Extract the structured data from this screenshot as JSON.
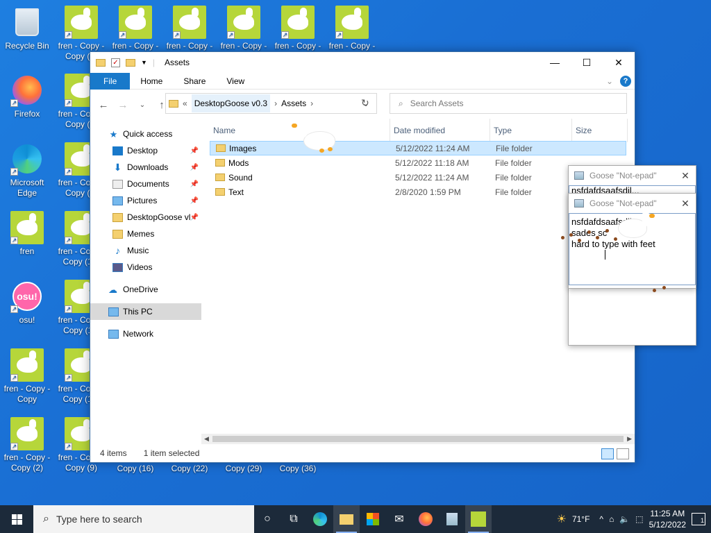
{
  "desktop": {
    "icons": [
      {
        "label": "Recycle Bin"
      },
      {
        "label": "fren - Copy - Copy (5)"
      },
      {
        "label": "fren - Copy - Copy (8)"
      },
      {
        "label": "fren - Copy - Copy (13)"
      },
      {
        "label": "fren - Copy - Copy (21)"
      },
      {
        "label": "fren - Copy - Copy (28)"
      },
      {
        "label": "fren - Copy - Copy (35)"
      },
      {
        "label": "Firefox"
      },
      {
        "label": "fren - Copy - Copy (4)"
      },
      {
        "label": "Microsoft Edge"
      },
      {
        "label": "fren - Copy - Copy (3)"
      },
      {
        "label": "fren"
      },
      {
        "label": "fren - Copy - Copy (12)"
      },
      {
        "label": "osu!"
      },
      {
        "label": "fren - Copy - Copy (11)"
      },
      {
        "label": "fren - Copy - Copy"
      },
      {
        "label": "fren - Copy - Copy (10)"
      },
      {
        "label": "fren - Copy - Copy (2)"
      },
      {
        "label": "fren - Copy - Copy (9)"
      }
    ],
    "bottom_labels": [
      "Copy (16)",
      "Copy (22)",
      "Copy (29)",
      "Copy (36)"
    ],
    "osu_glyph": "osu!"
  },
  "explorer": {
    "title": "Assets",
    "ribbon_tabs": {
      "file": "File",
      "home": "Home",
      "share": "Share",
      "view": "View"
    },
    "address": {
      "crumb_prefix": "«",
      "crumb1": "DesktopGoose v0.3",
      "crumb2": "Assets"
    },
    "search_placeholder": "Search Assets",
    "nav": {
      "quick_access": "Quick access",
      "desktop": "Desktop",
      "downloads": "Downloads",
      "documents": "Documents",
      "pictures": "Pictures",
      "desktopgoose": "DesktopGoose vl",
      "memes": "Memes",
      "music": "Music",
      "videos": "Videos",
      "onedrive": "OneDrive",
      "thispc": "This PC",
      "network": "Network"
    },
    "columns": {
      "name": "Name",
      "date": "Date modified",
      "type": "Type",
      "size": "Size"
    },
    "files": [
      {
        "name": "Images",
        "date": "5/12/2022 11:24 AM",
        "type": "File folder"
      },
      {
        "name": "Mods",
        "date": "5/12/2022 11:18 AM",
        "type": "File folder"
      },
      {
        "name": "Sound",
        "date": "5/12/2022 11:24 AM",
        "type": "File folder"
      },
      {
        "name": "Text",
        "date": "2/8/2020 1:59 PM",
        "type": "File folder"
      }
    ],
    "status": {
      "count": "4 items",
      "selected": "1 item selected"
    }
  },
  "notepads": [
    {
      "title": "Goose \"Not-epad\"",
      "text": "nsfdafdsaafsdil..."
    },
    {
      "title": "Goose \"Not-epad\"",
      "line1": "nsfdafdsaafsdil",
      "line2": "sades sc",
      "line3": "hard to type with feet"
    }
  ],
  "taskbar": {
    "search_placeholder": "Type here to search",
    "weather": "71°F",
    "time": "11:25 AM",
    "date": "5/12/2022",
    "notif_count": "1"
  },
  "colors": {
    "accent": "#1979ca",
    "selection": "#cce8ff",
    "taskbar": "#1c2a3a"
  }
}
